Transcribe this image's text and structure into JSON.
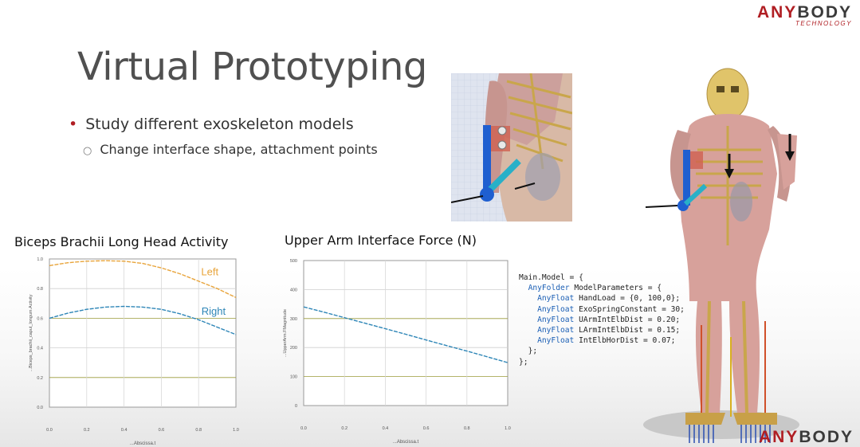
{
  "logo": {
    "brand_red": "ANY",
    "brand_dark": "BODY",
    "tagline": "TECHNOLOGY"
  },
  "logo_bottom": {
    "brand_red": "ANY",
    "brand_dark": "BODY"
  },
  "slide": {
    "title": "Virtual Prototyping",
    "bullet_main": "Study different exoskeleton models",
    "bullet_sub": "Change interface shape, attachment points"
  },
  "colors": {
    "accent": "#b01e23",
    "orange_series": "#e8a43a",
    "blue_series": "#2e86b7",
    "olive_grid": "#9b9b3a"
  },
  "chart_data": [
    {
      "type": "line",
      "title": "Biceps Brachii Long Head Activity",
      "xlabel": "...Abscissa.t",
      "ylabel": "...Biceps_brachii_caput_longum.Activity",
      "xlim": [
        0,
        1
      ],
      "ylim": [
        0,
        1
      ],
      "xticks": [
        "0.0",
        "0.2",
        "0.4",
        "0.6",
        "0.8",
        "1.0"
      ],
      "yticks": [
        "0.0",
        "0.2",
        "0.4",
        "0.6",
        "0.8",
        "1.0"
      ],
      "grid": true,
      "series": [
        {
          "name": "Left",
          "color": "#e8a43a",
          "x": [
            0,
            0.1,
            0.2,
            0.3,
            0.4,
            0.5,
            0.6,
            0.7,
            0.8,
            0.9,
            1.0
          ],
          "y": [
            0.955,
            0.975,
            0.985,
            0.988,
            0.985,
            0.97,
            0.94,
            0.9,
            0.85,
            0.8,
            0.74
          ]
        },
        {
          "name": "Right",
          "color": "#2e86b7",
          "x": [
            0,
            0.1,
            0.2,
            0.3,
            0.4,
            0.5,
            0.6,
            0.7,
            0.8,
            0.9,
            1.0
          ],
          "y": [
            0.6,
            0.635,
            0.66,
            0.675,
            0.68,
            0.675,
            0.66,
            0.63,
            0.59,
            0.54,
            0.49
          ]
        }
      ]
    },
    {
      "type": "line",
      "title": "Upper Arm Interface Force (N)",
      "xlabel": "...Abscissa.t",
      "ylabel": "...UpperArm.FMagnitude",
      "xlim": [
        0,
        1
      ],
      "ylim": [
        0,
        500
      ],
      "xticks": [
        "0.0",
        "0.2",
        "0.4",
        "0.6",
        "0.8",
        "1.0"
      ],
      "yticks": [
        "0",
        "100",
        "200",
        "300",
        "400",
        "500"
      ],
      "grid": true,
      "series": [
        {
          "name": "",
          "color": "#2e86b7",
          "x": [
            0,
            0.1,
            0.2,
            0.3,
            0.4,
            0.5,
            0.6,
            0.7,
            0.8,
            0.9,
            1.0
          ],
          "y": [
            340,
            322,
            303,
            284,
            265,
            246,
            226,
            207,
            188,
            168,
            148
          ]
        }
      ]
    }
  ],
  "code": {
    "lines": [
      {
        "indent": 0,
        "kw": "",
        "text": "Main.Model = {"
      },
      {
        "indent": 1,
        "kw": "AnyFolder",
        "text": " ModelParameters = {"
      },
      {
        "indent": 2,
        "kw": "AnyFloat",
        "text": " HandLoad = {0, 100,0};"
      },
      {
        "indent": 2,
        "kw": "AnyFloat",
        "text": " ExoSpringConstant = 30;"
      },
      {
        "indent": 2,
        "kw": "AnyFloat",
        "text": " UArmIntElbDist = 0.20;"
      },
      {
        "indent": 2,
        "kw": "AnyFloat",
        "text": " LArmIntElbDist = 0.15;"
      },
      {
        "indent": 2,
        "kw": "AnyFloat",
        "text": " IntElbHorDist = 0.07;"
      },
      {
        "indent": 1,
        "kw": "",
        "text": "};"
      },
      {
        "indent": 0,
        "kw": "",
        "text": "};"
      }
    ]
  }
}
